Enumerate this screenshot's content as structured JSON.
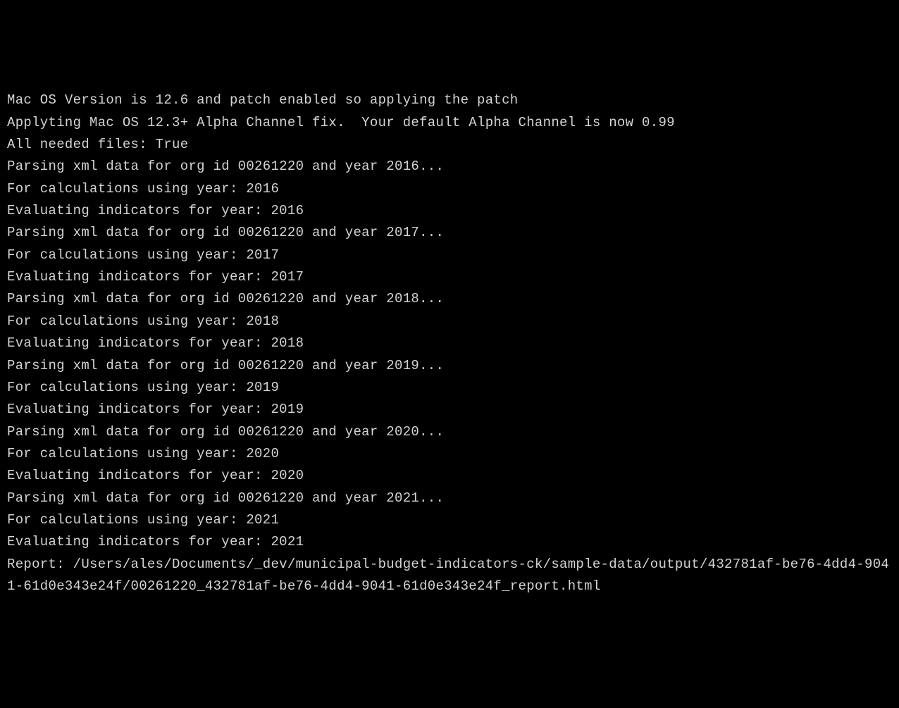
{
  "terminal": {
    "lines": [
      "Mac OS Version is 12.6 and patch enabled so applying the patch",
      "Applyting Mac OS 12.3+ Alpha Channel fix.  Your default Alpha Channel is now 0.99",
      "All needed files: True",
      "Parsing xml data for org id 00261220 and year 2016...",
      "For calculations using year: 2016",
      "Evaluating indicators for year: 2016",
      "Parsing xml data for org id 00261220 and year 2017...",
      "For calculations using year: 2017",
      "Evaluating indicators for year: 2017",
      "Parsing xml data for org id 00261220 and year 2018...",
      "For calculations using year: 2018",
      "Evaluating indicators for year: 2018",
      "Parsing xml data for org id 00261220 and year 2019...",
      "For calculations using year: 2019",
      "Evaluating indicators for year: 2019",
      "Parsing xml data for org id 00261220 and year 2020...",
      "For calculations using year: 2020",
      "Evaluating indicators for year: 2020",
      "Parsing xml data for org id 00261220 and year 2021...",
      "For calculations using year: 2021",
      "Evaluating indicators for year: 2021"
    ],
    "report_line": "Report: /Users/ales/Documents/_dev/municipal-budget-indicators-ck/sample-data/output/432781af-be76-4dd4-9041-61d0e343e24f/00261220_432781af-be76-4dd4-9041-61d0e343e24f_report.html"
  }
}
